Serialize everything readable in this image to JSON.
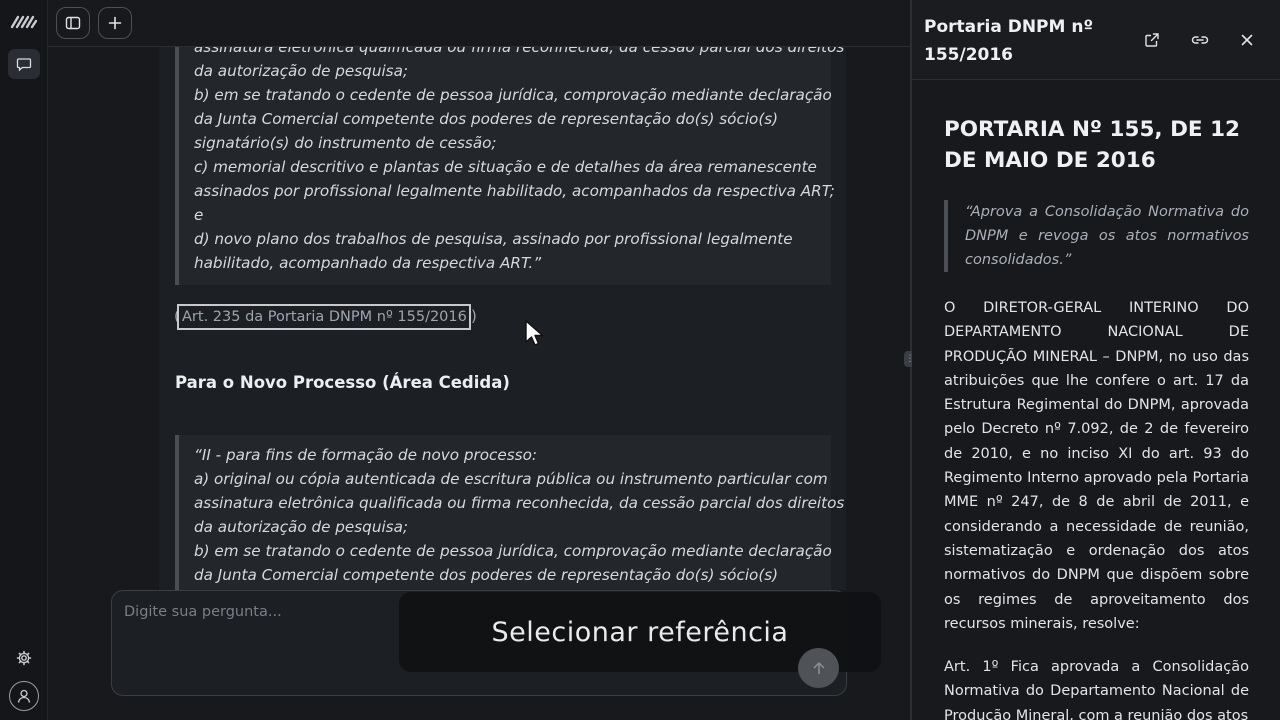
{
  "rail": {
    "logo_icon": "brand-logo",
    "chat_icon": "chat-bubble-icon",
    "settings_icon": "gear-icon",
    "user_icon": "user-avatar-icon"
  },
  "toolbar": {
    "sidebar_toggle_icon": "sidebar-toggle-icon",
    "new_chat_icon": "plus-icon"
  },
  "chat": {
    "quote1_lines": [
      "assinatura eletrônica qualificada ou firma reconhecida, da cessão parcial dos direitos",
      "da autorização de pesquisa;",
      "b) em se tratando o cedente de pessoa jurídica, comprovação mediante declaração",
      "da Junta Comercial competente dos poderes de representação do(s) sócio(s)",
      "signatário(s) do instrumento de cessão;",
      "c) memorial descritivo e plantas de situação e de detalhes da área remanescente",
      "assinados por profissional legalmente habilitado, acompanhados da respectiva ART;",
      "e",
      "d) novo plano dos trabalhos de pesquisa, assinado por profissional legalmente",
      "habilitado, acompanhado da respectiva ART.”"
    ],
    "reference_label": "Art. 235 da Portaria DNPM nº 155/2016",
    "reference_open": "(",
    "reference_close": ")",
    "section_heading": "Para o Novo Processo (Área Cedida)",
    "quote2_lines": [
      "“II - para fins de formação de novo processo:",
      "a) original ou cópia autenticada de escritura pública ou instrumento particular com",
      "assinatura eletrônica qualificada ou firma reconhecida, da cessão parcial dos direitos",
      "da autorização de pesquisa;",
      "b) em se tratando o cedente de pessoa jurídica, comprovação mediante declaração",
      "da Junta Comercial competente dos poderes de representação do(s) sócio(s)"
    ]
  },
  "input": {
    "placeholder": "Digite sua pergunta...",
    "value": "",
    "send_icon": "arrow-up-icon"
  },
  "overlay": {
    "label": "Selecionar referência"
  },
  "panel": {
    "title": "Portaria DNPM nº 155/2016",
    "open_icon": "external-link-icon",
    "link_icon": "link-icon",
    "close_icon": "close-icon",
    "doc_title": "PORTARIA Nº 155, DE 12 DE MAIO DE 2016",
    "doc_summary": "“Aprova a Consolidação Normativa do DNPM e revoga os atos normativos consolidados.”",
    "doc_paragraph1": "O DIRETOR-GERAL INTERINO DO DEPARTAMENTO NACIONAL DE PRODUÇÃO MINERAL – DNPM, no uso das atribuições que lhe confere o art. 17 da Estrutura Regimental do DNPM, aprovada pelo Decreto nº 7.092, de 2 de fevereiro de 2010, e no inciso XI do art. 93 do Regimento Interno aprovado pela Portaria MME nº 247, de 8 de abril de 2011, e considerando a necessidade de reunião, sistematização e ordenação dos atos normativos do DNPM que dispõem sobre os regimes de aproveitamento dos recursos minerais, resolve:",
    "doc_paragraph2": "Art. 1º Fica aprovada a Consolidação Normativa do Departamento Nacional de Produção Mineral, com a reunião dos atos"
  }
}
